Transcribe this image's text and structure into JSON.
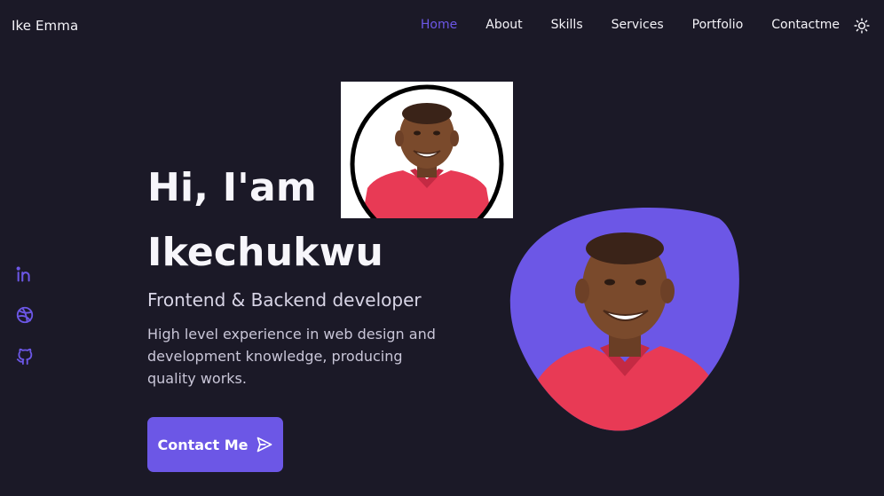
{
  "nav": {
    "brand": "Ike Emma",
    "links": [
      "Home",
      "About",
      "Skills",
      "Services",
      "Portfolio",
      "Contactme"
    ],
    "active_index": 0,
    "theme_icon": "sun-icon"
  },
  "social": [
    {
      "icon": "linkedin-icon"
    },
    {
      "icon": "dribbble-icon"
    },
    {
      "icon": "github-icon"
    }
  ],
  "hero": {
    "greeting": "Hi, I'am",
    "name": "Ikechukwu",
    "subtitle": "Frontend & Backend developer",
    "description": "High level experience in web design and development knowledge, producing quality works.",
    "cta_label": "Contact Me",
    "cta_icon": "send-icon"
  },
  "colors": {
    "background": "#1b1927",
    "accent": "#6c57e6",
    "text": "#f4f3f8"
  }
}
